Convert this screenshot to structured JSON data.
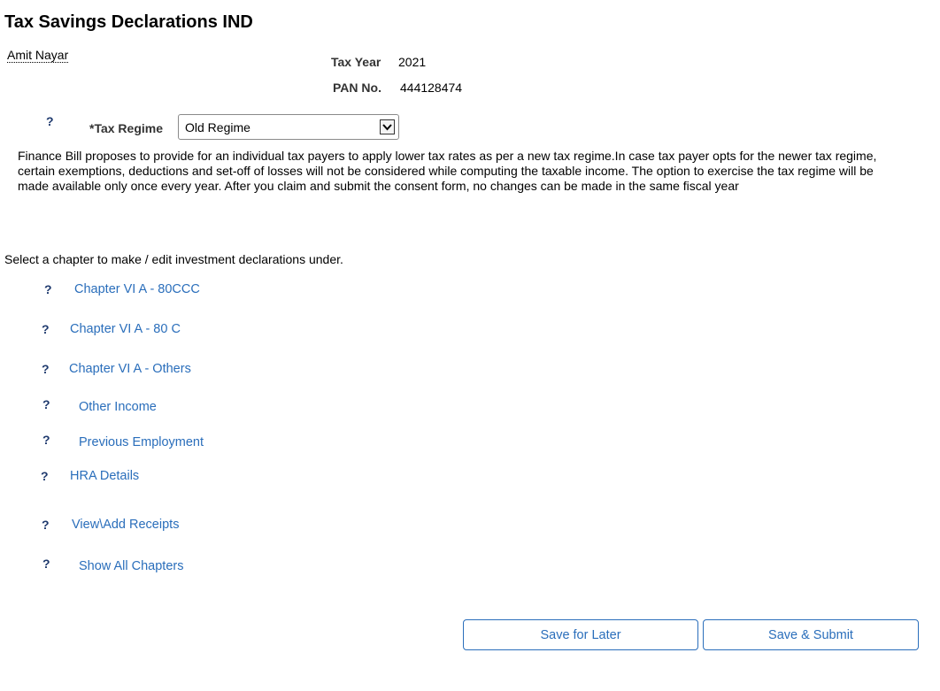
{
  "page": {
    "title": "Tax Savings Declarations IND"
  },
  "employee": {
    "name": "Amit Nayar"
  },
  "tax_info": {
    "tax_year_label": "Tax Year",
    "tax_year_value": "2021",
    "pan_label": "PAN No.",
    "pan_value": "444128474"
  },
  "regime": {
    "help": "?",
    "label": "*Tax Regime",
    "selected": "Old Regime"
  },
  "info_text": "Finance Bill proposes to provide for an individual tax payers to apply lower tax rates as per a new tax regime.In case tax payer opts for the newer tax regime, certain exemptions, deductions and set-off of losses will not be considered while computing the taxable income. The option to exercise the tax regime will be made available only once every year. After you claim and submit the consent form, no changes can be made in the same fiscal year",
  "instruction": "Select a chapter to make / edit investment declarations under.",
  "chapters": [
    {
      "help": "?",
      "label": "Chapter VI A - 80CCC"
    },
    {
      "help": "?",
      "label": "Chapter VI A - 80 C"
    },
    {
      "help": "?",
      "label": "Chapter VI A - Others"
    },
    {
      "help": "?",
      "label": "Other Income"
    },
    {
      "help": "?",
      "label": "Previous Employment"
    },
    {
      "help": "?",
      "label": "HRA Details"
    },
    {
      "help": "?",
      "label": "View\\Add Receipts"
    },
    {
      "help": "?",
      "label": "Show All Chapters"
    }
  ],
  "actions": {
    "save_later": "Save for Later",
    "save_submit": "Save & Submit"
  },
  "icons": {
    "help": "question-mark-icon",
    "dropdown": "chevron-down-icon"
  },
  "colors": {
    "link": "#2a6ebb",
    "help": "#1f3a6e"
  }
}
